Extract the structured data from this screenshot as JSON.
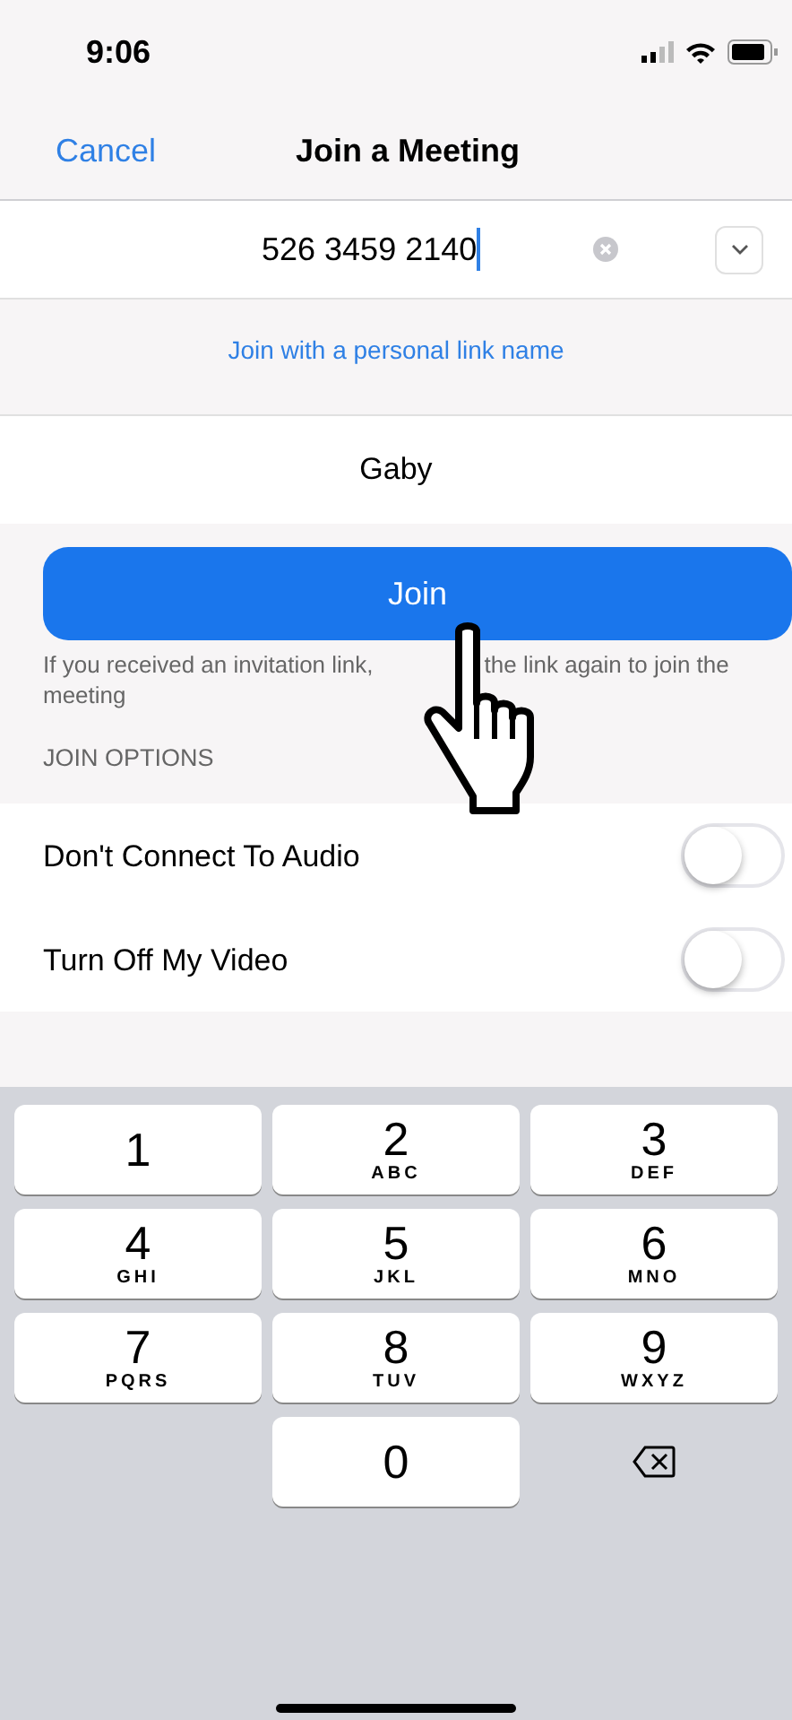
{
  "status_bar": {
    "time": "9:06"
  },
  "nav": {
    "cancel": "Cancel",
    "title": "Join a Meeting"
  },
  "meeting_id": {
    "value": "526 3459 2140"
  },
  "personal_link": "Join with a personal link name",
  "name_field": {
    "value": "Gaby"
  },
  "join_button": "Join",
  "hint": {
    "before": "If you received an invitation link,",
    "after": "the link again to join the meeting"
  },
  "join_options": {
    "header": "JOIN OPTIONS",
    "items": [
      {
        "label": "Don't Connect To Audio",
        "on": false
      },
      {
        "label": "Turn Off My Video",
        "on": false
      }
    ]
  },
  "keyboard": [
    {
      "kind": "digit",
      "digit": "1"
    },
    {
      "kind": "digit",
      "digit": "2",
      "letters": "ABC"
    },
    {
      "kind": "digit",
      "digit": "3",
      "letters": "DEF"
    },
    {
      "kind": "digit",
      "digit": "4",
      "letters": "GHI"
    },
    {
      "kind": "digit",
      "digit": "5",
      "letters": "JKL"
    },
    {
      "kind": "digit",
      "digit": "6",
      "letters": "MNO"
    },
    {
      "kind": "digit",
      "digit": "7",
      "letters": "PQRS"
    },
    {
      "kind": "digit",
      "digit": "8",
      "letters": "TUV"
    },
    {
      "kind": "digit",
      "digit": "9",
      "letters": "WXYZ"
    },
    {
      "kind": "blank"
    },
    {
      "kind": "digit",
      "digit": "0"
    },
    {
      "kind": "backspace"
    }
  ]
}
